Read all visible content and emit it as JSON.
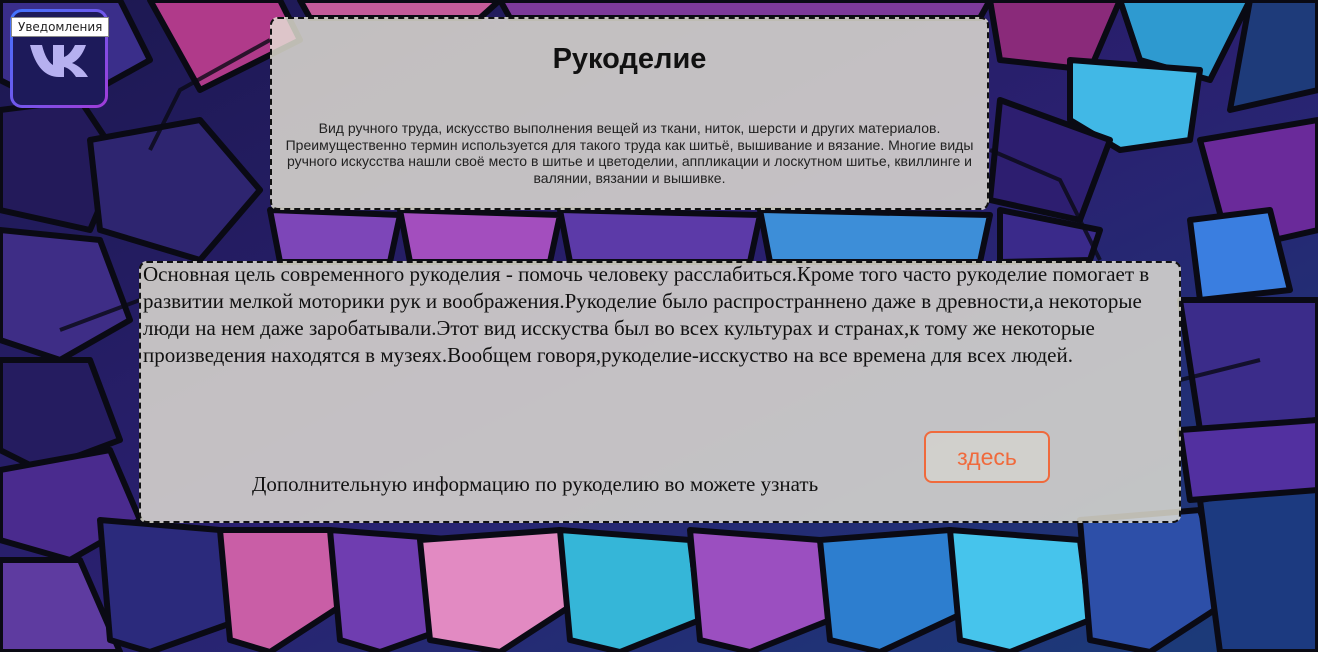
{
  "vk": {
    "tooltip": "Уведомления"
  },
  "intro": {
    "title": "Рукоделие",
    "description": "Вид ручного труда, искусство выполнения вещей из ткани, ниток, шерсти и других материалов. Преимущественно термин используется для такого труда как шитьё, вышивание и вязание. Многие виды ручного искусства нашли своё место в шитье и цветоделии, аппликации и лоскутном шитье, квиллинге и валянии, вязании и вышивке."
  },
  "main": {
    "text": "Основная цель современного рукоделия - помочь человеку расслабиться.Кроме того часто рукоделие помогает в развитии мелкой моторики рук и воображения.Рукоделие было распространнено даже в древности,а некоторые люди на нем даже заробатывали.Этот вид исскуства был во всех культурах и странах,к тому же некоторые произведения находятся в музеях.Вообщем говоря,рукоделие-исскуство на все времена для всех людей.",
    "extra_info": "Дополнительную информацию по рукоделию во можете узнать",
    "link_label": "здесь"
  }
}
